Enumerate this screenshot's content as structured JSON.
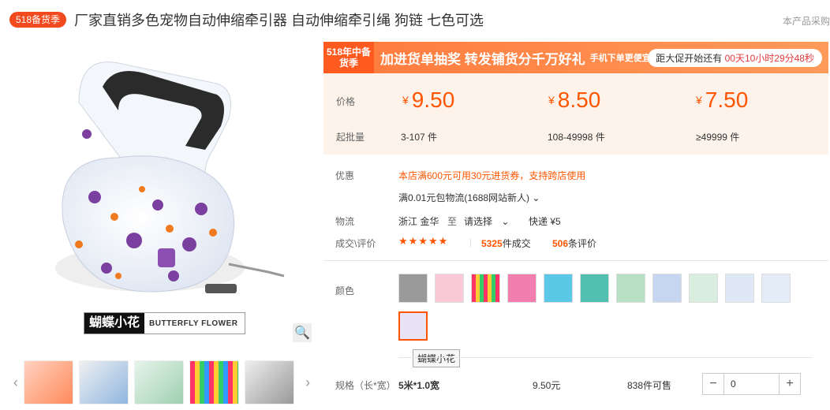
{
  "header": {
    "badge": "518备货季",
    "title": "厂家直销多色宠物自动伸缩牵引器 自动伸缩牵引绳 狗链 七色可选",
    "right_text": "本产品采购"
  },
  "gallery": {
    "brand_cn": "蝴蝶小花",
    "brand_en": "BUTTERFLY FLOWER",
    "thumb_count": 5
  },
  "promo": {
    "tag": "518年中备货季",
    "text": "加进货单抽奖 转发铺货分千万好礼",
    "sub": "手机下单更便宜",
    "countdown_prefix": "距大促开始还有",
    "countdown": "00天10小时29分48秒"
  },
  "pricing": {
    "price_label": "价格",
    "qty_label": "起批量",
    "currency": "¥",
    "tiers": [
      {
        "price": "9.50",
        "qty": "3-107 件"
      },
      {
        "price": "8.50",
        "qty": "108-49998 件"
      },
      {
        "price": "7.50",
        "qty": "≥49999 件"
      }
    ]
  },
  "offers": {
    "label": "优惠",
    "coupon": "本店满600元可用30元进货券，支持跨店使用",
    "shipping": "满0.01元包物流(1688网站新人)"
  },
  "logistics": {
    "label": "物流",
    "from": "浙江 金华",
    "to_label": "至",
    "to": "请选择",
    "express": "快递 ¥5"
  },
  "rating": {
    "label": "成交\\评价",
    "stars": "★★★★★",
    "deals": "5325",
    "deals_suffix": "件成交",
    "reviews": "506",
    "reviews_suffix": "条评价"
  },
  "colors": {
    "label": "颜色",
    "tooltip": "蝴蝶小花"
  },
  "spec": {
    "label": "规格（长*宽）",
    "value": "5米*1.0宽",
    "price": "9.50元",
    "stock": "838件可售",
    "quantity": "0",
    "minus": "−",
    "plus": "+"
  }
}
